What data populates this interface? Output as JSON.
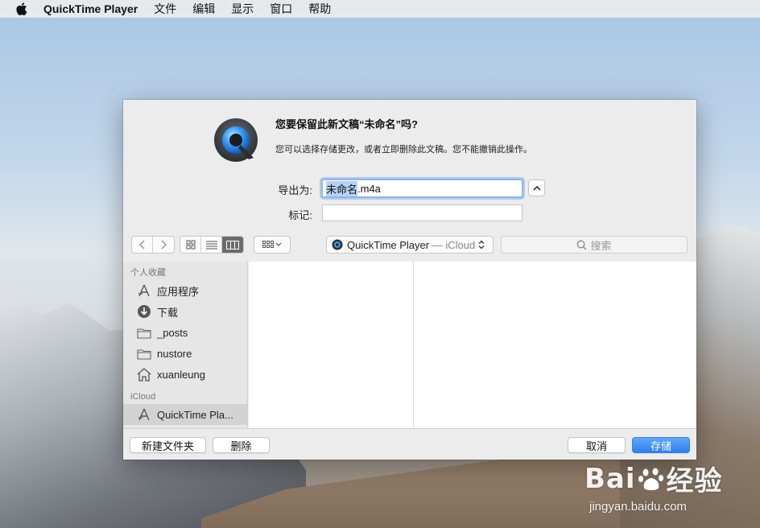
{
  "menubar": {
    "app_name": "QuickTime Player",
    "items": [
      "文件",
      "编辑",
      "显示",
      "窗口",
      "帮助"
    ]
  },
  "dialog": {
    "title": "您要保留此新文稿“未命名”吗?",
    "subtitle": "您可以选择存储更改，或者立即删除此文稿。您不能撤销此操作。",
    "export_label": "导出为:",
    "filename_selected": "未命名",
    "filename_ext": ".m4a",
    "tags_label": "标记:",
    "tags_value": ""
  },
  "toolbar": {
    "location": "QuickTime Player",
    "location_sep": " — iCloud",
    "search_placeholder": "搜索",
    "active_view": "column"
  },
  "sidebar": {
    "favorites_header": "个人收藏",
    "favorites": [
      {
        "label": "应用程序",
        "icon": "applications-icon"
      },
      {
        "label": "下载",
        "icon": "downloads-icon"
      },
      {
        "label": "_posts",
        "icon": "folder-icon"
      },
      {
        "label": "nustore",
        "icon": "folder-icon"
      },
      {
        "label": "xuanleung",
        "icon": "home-icon"
      }
    ],
    "icloud_header": "iCloud",
    "icloud": [
      {
        "label": "QuickTime Pla...",
        "icon": "applications-icon",
        "selected": true
      }
    ]
  },
  "footer": {
    "new_folder": "新建文件夹",
    "delete": "删除",
    "cancel": "取消",
    "save": "存储"
  },
  "watermark": {
    "logo_left": "Bai",
    "logo_right": "经验",
    "url": "jingyan.baidu.com"
  },
  "colors": {
    "accent": "#2f7fef",
    "selection": "#b4d2f5"
  }
}
